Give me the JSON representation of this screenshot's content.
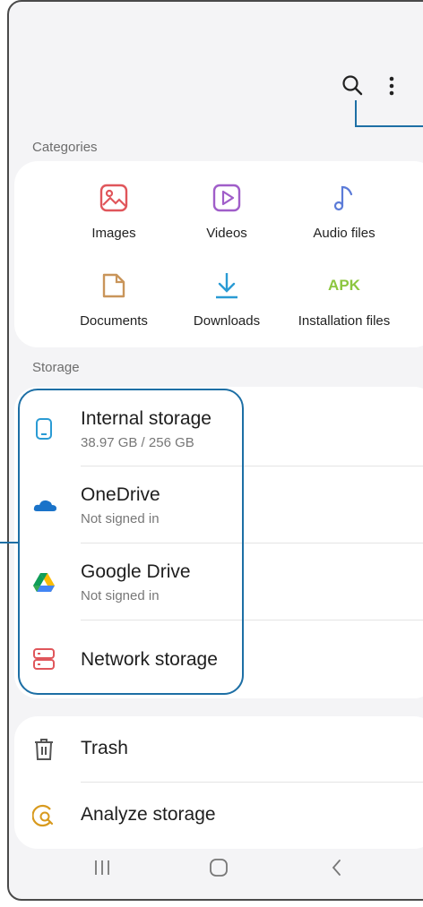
{
  "header": {
    "search_icon": "search-icon",
    "more_icon": "more-options-icon"
  },
  "categories": {
    "label": "Categories",
    "items": [
      {
        "label": "Images",
        "icon": "image-icon",
        "color": "#e0565b"
      },
      {
        "label": "Videos",
        "icon": "video-icon",
        "color": "#a05ec9"
      },
      {
        "label": "Audio files",
        "icon": "music-note-icon",
        "color": "#5b7bd8"
      },
      {
        "label": "Documents",
        "icon": "document-icon",
        "color": "#c9955a"
      },
      {
        "label": "Downloads",
        "icon": "download-icon",
        "color": "#2a9bd4"
      },
      {
        "label": "Installation files",
        "icon": "apk-icon",
        "icon_text": "APK",
        "color": "#8cc63f"
      }
    ]
  },
  "storage": {
    "label": "Storage",
    "items": [
      {
        "title": "Internal storage",
        "subtitle": "38.97 GB / 256 GB",
        "icon": "phone-icon"
      },
      {
        "title": "OneDrive",
        "subtitle": "Not signed in",
        "icon": "onedrive-icon"
      },
      {
        "title": "Google Drive",
        "subtitle": "Not signed in",
        "icon": "google-drive-icon"
      },
      {
        "title": "Network storage",
        "icon": "network-storage-icon"
      }
    ]
  },
  "tools": {
    "items": [
      {
        "title": "Trash",
        "icon": "trash-icon"
      },
      {
        "title": "Analyze storage",
        "icon": "analyze-storage-icon"
      }
    ]
  },
  "navbar": {
    "recents_icon": "recents-icon",
    "home_icon": "home-icon",
    "back_icon": "back-icon"
  },
  "colors": {
    "callout": "#1d6fa5",
    "background": "#f4f4f6",
    "card": "#ffffff"
  }
}
